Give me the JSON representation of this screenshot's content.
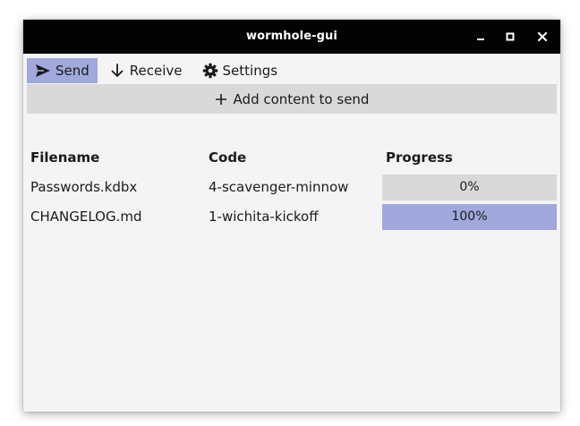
{
  "window": {
    "title": "wormhole-gui"
  },
  "tabs": [
    {
      "label": "Send",
      "icon": "send-icon",
      "active": true
    },
    {
      "label": "Receive",
      "icon": "arrow-down-icon",
      "active": false
    },
    {
      "label": "Settings",
      "icon": "gear-icon",
      "active": false
    }
  ],
  "add_button": {
    "label": "Add content to send",
    "icon": "plus-icon"
  },
  "table": {
    "headers": {
      "filename": "Filename",
      "code": "Code",
      "progress": "Progress"
    },
    "rows": [
      {
        "filename": "Passwords.kdbx",
        "code": "4-scavenger-minnow",
        "progress_label": "0%",
        "progress": 0
      },
      {
        "filename": "CHANGELOG.md",
        "code": "1-wichita-kickoff",
        "progress_label": "100%",
        "progress": 100
      }
    ]
  },
  "colors": {
    "accent": "#a0a8dc",
    "titlebar": "#030303",
    "button_bg": "#d9d9d9",
    "window_bg": "#f4f4f4"
  }
}
